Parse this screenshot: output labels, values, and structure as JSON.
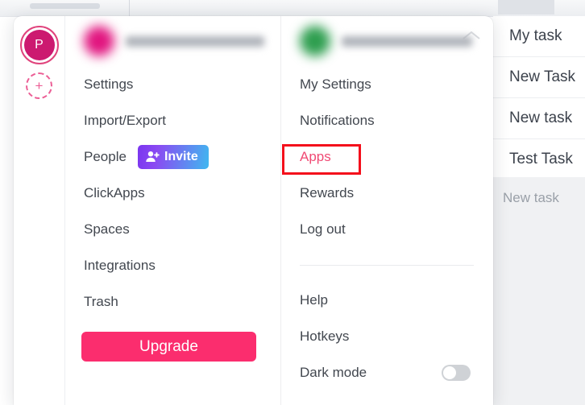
{
  "background": {
    "tasks": [
      {
        "label": "My task"
      },
      {
        "label": "New Task"
      },
      {
        "label": "New task"
      },
      {
        "label": "Test Task"
      }
    ],
    "ghost_task": "New task"
  },
  "rail": {
    "workspace_initial": "P",
    "add_workspace_label": "+"
  },
  "workspace_menu": {
    "header": {
      "name": "",
      "avatar_color": "#e1157f"
    },
    "items": [
      {
        "label": "Settings"
      },
      {
        "label": "Import/Export"
      },
      {
        "label": "People",
        "action": "Invite"
      },
      {
        "label": "ClickApps"
      },
      {
        "label": "Spaces"
      },
      {
        "label": "Integrations"
      },
      {
        "label": "Trash"
      }
    ],
    "invite_label": "Invite",
    "upgrade_label": "Upgrade"
  },
  "user_menu": {
    "header": {
      "name": "",
      "avatar_color": "#2e9e4f"
    },
    "items": [
      {
        "label": "My Settings"
      },
      {
        "label": "Notifications"
      },
      {
        "label": "Apps"
      },
      {
        "label": "Rewards"
      },
      {
        "label": "Log out"
      }
    ],
    "secondary_items": [
      {
        "label": "Help"
      },
      {
        "label": "Hotkeys"
      }
    ],
    "dark_mode_label": "Dark mode",
    "dark_mode_on": false
  },
  "colors": {
    "accent_pink": "#fb2d6e",
    "highlight_red": "#f40f1b",
    "apps_text": "#f04a74",
    "invite_gradient_start": "#7b35f0",
    "invite_gradient_end": "#3fb8f0"
  }
}
